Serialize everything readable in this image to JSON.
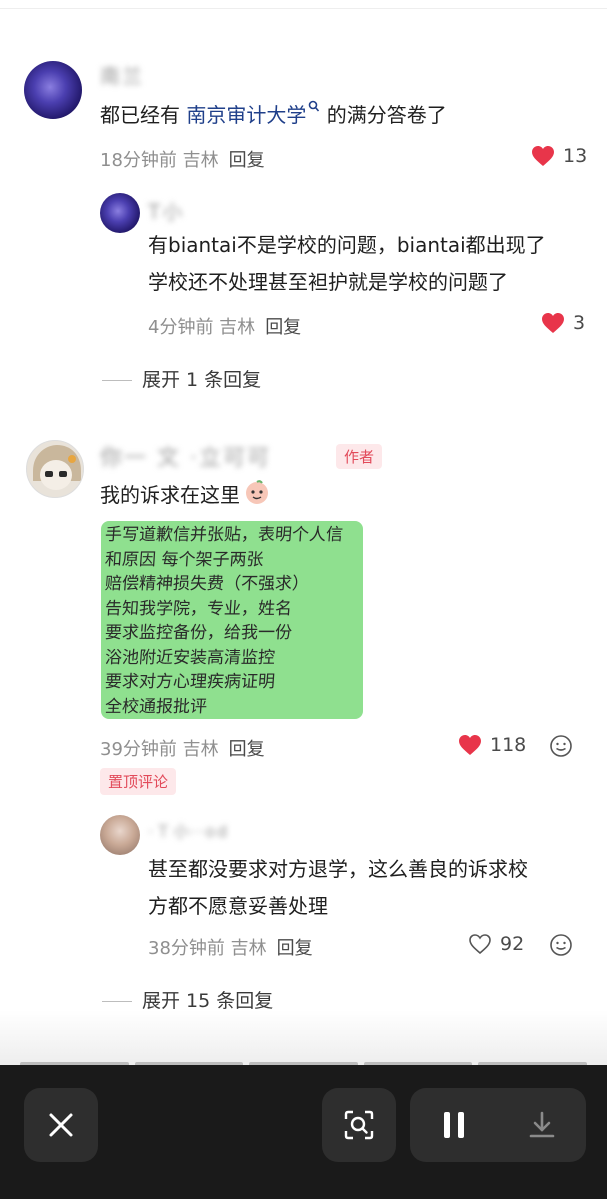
{
  "comments": [
    {
      "text_before": "都已经有 ",
      "link": "南京审计大学",
      "link_icon": "search-icon",
      "text_after": " 的满分答卷了",
      "time": "18分钟前 吉林",
      "reply": "回复",
      "likes": "13",
      "replies": [
        {
          "line1": "有biantai不是学校的问题，biantai都出现了",
          "line2": "学校还不处理甚至袒护就是学校的问题了",
          "time": "4分钟前 吉林",
          "reply": "回复",
          "likes": "3"
        }
      ],
      "expand": "展开 1 条回复"
    },
    {
      "author_tag": "作者",
      "text": "我的诉求在这里",
      "note_lines": [
        "手写道歉信并张贴，表明个人信",
        "和原因 每个架子两张",
        "赔偿精神损失费（不强求）",
        "告知我学院，专业，姓名",
        "要求监控备份，给我一份",
        "浴池附近安装高清监控",
        "要求对方心理疾病证明",
        "全校通报批评"
      ],
      "time": "39分钟前 吉林",
      "reply": "回复",
      "likes": "118",
      "pin_tag": "置顶评论",
      "replies": [
        {
          "line1": "甚至都没要求对方退学，这么善良的诉求校",
          "line2": "方都不愿意妥善处理",
          "time": "38分钟前 吉林",
          "reply": "回复",
          "likes": "92"
        }
      ],
      "expand": "展开 15 条回复"
    }
  ],
  "colors": {
    "like_red": "#e8354a",
    "author_tag_bg": "#fde8ea",
    "author_tag_text": "#e24a5a",
    "link_blue": "#1f3f8a",
    "note_green": "#8fe08f",
    "bottom_bar": "#1a1a1a"
  },
  "bottom_bar": {
    "close_icon": "close-icon",
    "lens_icon": "lens-search-icon",
    "pause_icon": "pause-icon",
    "download_icon": "download-icon"
  }
}
